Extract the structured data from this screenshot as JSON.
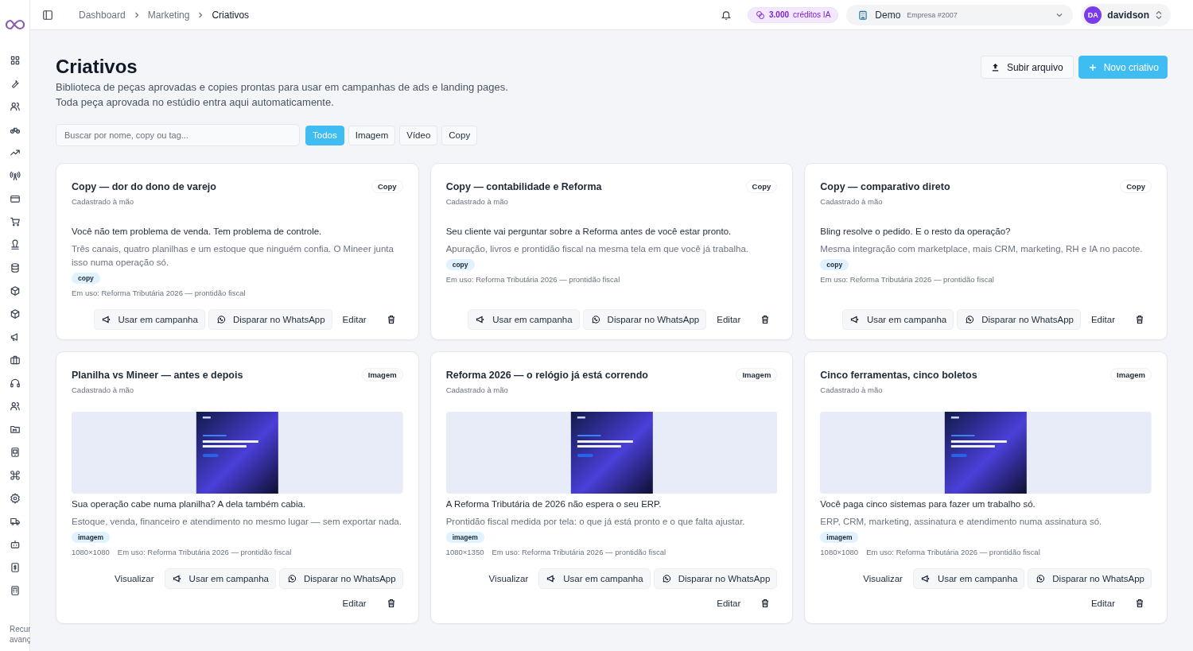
{
  "sidebar": {
    "items": [
      {
        "kind": "grid"
      },
      {
        "kind": "wrench"
      },
      {
        "kind": "users"
      },
      {
        "kind": "bike"
      },
      {
        "kind": "trend"
      },
      {
        "kind": "antenna"
      },
      {
        "kind": "card"
      },
      {
        "kind": "cart"
      },
      {
        "kind": "stamp"
      },
      {
        "kind": "database"
      },
      {
        "kind": "box"
      },
      {
        "kind": "box"
      },
      {
        "kind": "megaphone"
      },
      {
        "kind": "briefcase"
      },
      {
        "kind": "headset"
      },
      {
        "kind": "users"
      },
      {
        "kind": "folder"
      },
      {
        "kind": "tablet"
      },
      {
        "kind": "command"
      },
      {
        "kind": "gear"
      },
      {
        "kind": "truck"
      },
      {
        "kind": "bot"
      },
      {
        "kind": "dollar"
      },
      {
        "kind": "calculator"
      }
    ],
    "footer_lines": [
      "Recur",
      "avanç"
    ]
  },
  "breadcrumb": [
    {
      "label": "Dashboard",
      "current": false
    },
    {
      "label": "Marketing",
      "current": false
    },
    {
      "label": "Criativos",
      "current": true
    }
  ],
  "credits": {
    "amount": "3.000",
    "label": "créditos IA"
  },
  "company": {
    "name": "Demo",
    "detail": "Empresa #2007"
  },
  "user": {
    "initials": "DA",
    "name": "davidson"
  },
  "page": {
    "title": "Criativos",
    "description": [
      "Biblioteca de peças aprovadas e copies prontas para usar em campanhas de ads e landing pages.",
      "Toda peça aprovada no estúdio entra aqui automaticamente."
    ],
    "buttons": [
      {
        "label": "Subir arquivo",
        "kind": "upload"
      },
      {
        "label": "Novo criativo",
        "kind": "primary"
      }
    ]
  },
  "search": {
    "placeholder": "Buscar por nome, copy ou tag..."
  },
  "filters": [
    {
      "label": "Todos",
      "selected": true
    },
    {
      "label": "Imagem",
      "selected": false
    },
    {
      "label": "Vídeo",
      "selected": false
    },
    {
      "label": "Copy",
      "selected": false
    }
  ],
  "cards": [
    {
      "title": "Copy — dor do dono de varejo",
      "type": "Copy",
      "source": "Cadastrado à mão",
      "headline": "Você não tem problema de venda. Tem problema de controle.",
      "body": "Três canais, quatro planilhas e um estoque que ninguém confia. O Mineer junta isso numa operação só.",
      "tag": "copy",
      "in_use": "Em uso: Reforma Tributária 2026 — prontidão fiscal",
      "actions": [
        {
          "kind": "campaign",
          "label": "Usar em campanha"
        },
        {
          "kind": "whatsapp",
          "label": "Disparar no WhatsApp"
        },
        {
          "kind": "text",
          "label": "Editar"
        },
        {
          "kind": "delete"
        }
      ]
    },
    {
      "title": "Copy — contabilidade e Reforma",
      "type": "Copy",
      "source": "Cadastrado à mão",
      "headline": "Seu cliente vai perguntar sobre a Reforma antes de você estar pronto.",
      "body": "Apuração, livros e prontidão fiscal na mesma tela em que você já trabalha.",
      "tag": "copy",
      "in_use": "Em uso: Reforma Tributária 2026 — prontidão fiscal",
      "actions": [
        {
          "kind": "campaign",
          "label": "Usar em campanha"
        },
        {
          "kind": "whatsapp",
          "label": "Disparar no WhatsApp"
        },
        {
          "kind": "text",
          "label": "Editar"
        },
        {
          "kind": "delete"
        }
      ]
    },
    {
      "title": "Copy — comparativo direto",
      "type": "Copy",
      "source": "Cadastrado à mão",
      "headline": "Bling resolve o pedido. E o resto da operação?",
      "body": "Mesma integração com marketplace, mais CRM, marketing, RH e IA no pacote.",
      "tag": "copy",
      "in_use": "Em uso: Reforma Tributária 2026 — prontidão fiscal",
      "actions": [
        {
          "kind": "campaign",
          "label": "Usar em campanha"
        },
        {
          "kind": "whatsapp",
          "label": "Disparar no WhatsApp"
        },
        {
          "kind": "text",
          "label": "Editar"
        },
        {
          "kind": "delete"
        }
      ]
    },
    {
      "title": "Planilha vs Mineer — antes e depois",
      "type": "Imagem",
      "source": "Cadastrado à mão",
      "image": {
        "kind": "picture"
      },
      "headline": "Sua operação cabe numa planilha? A dela também cabia.",
      "body": "Estoque, venda, financeiro e atendimento no mesmo lugar — sem exportar nada.",
      "tag": "imagem",
      "size": "1080×1080",
      "in_use": "Em uso: Reforma Tributária 2026 — prontidão fiscal",
      "actions": [
        {
          "kind": "text",
          "label": "Visualizar"
        },
        {
          "kind": "campaign",
          "label": "Usar em campanha"
        },
        {
          "kind": "whatsapp",
          "label": "Disparar no WhatsApp"
        },
        {
          "kind": "text",
          "label": "Editar"
        },
        {
          "kind": "delete"
        }
      ]
    },
    {
      "title": "Reforma 2026 — o relógio já está correndo",
      "type": "Imagem",
      "source": "Cadastrado à mão",
      "image": {
        "kind": "picture"
      },
      "headline": "A Reforma Tributária de 2026 não espera o seu ERP.",
      "body": "Prontidão fiscal medida por tela: o que já está pronto e o que falta ajustar.",
      "tag": "imagem",
      "size": "1080×1350",
      "in_use": "Em uso: Reforma Tributária 2026 — prontidão fiscal",
      "actions": [
        {
          "kind": "text",
          "label": "Visualizar"
        },
        {
          "kind": "campaign",
          "label": "Usar em campanha"
        },
        {
          "kind": "whatsapp",
          "label": "Disparar no WhatsApp"
        },
        {
          "kind": "text",
          "label": "Editar"
        },
        {
          "kind": "delete"
        }
      ]
    },
    {
      "title": "Cinco ferramentas, cinco boletos",
      "type": "Imagem",
      "source": "Cadastrado à mão",
      "image": {
        "kind": "picture"
      },
      "headline": "Você paga cinco sistemas para fazer um trabalho só.",
      "body": "ERP, CRM, marketing, assinatura e atendimento numa assinatura só.",
      "tag": "imagem",
      "size": "1080×1080",
      "in_use": "Em uso: Reforma Tributária 2026 — prontidão fiscal",
      "actions": [
        {
          "kind": "text",
          "label": "Visualizar"
        },
        {
          "kind": "campaign",
          "label": "Usar em campanha"
        },
        {
          "kind": "whatsapp",
          "label": "Disparar no WhatsApp"
        },
        {
          "kind": "text",
          "label": "Editar"
        },
        {
          "kind": "delete"
        }
      ]
    }
  ]
}
